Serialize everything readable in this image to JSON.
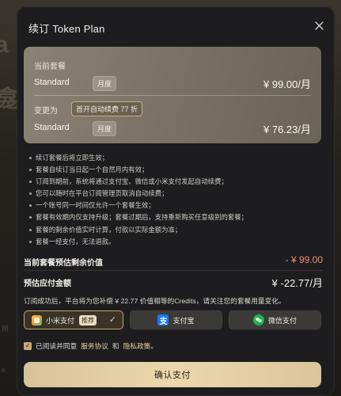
{
  "background": {
    "glyph_1": "a",
    "glyph_2": "龛",
    "small_1": "用",
    "small_2": "e"
  },
  "modal": {
    "title": "续订 Token Plan",
    "close_icon": "close-icon"
  },
  "plan_card": {
    "current_label": "当前套餐",
    "current_plan": "Standard",
    "current_cycle": "月度",
    "current_price": "¥ 99.00/月",
    "change_label": "变更为",
    "promo_badge": "首开自动续费 77 折",
    "new_plan": "Standard",
    "new_cycle": "月度",
    "new_price": "¥ 76.23/月"
  },
  "rules": [
    "续订套餐后将立即生效；",
    "套餐自续订当日起一个自然月内有效；",
    "订阅到期前，系统将通过支付宝、微信或小米支付发起自动续费；",
    "您可以随时在平台订阅管理页取消自动续费；",
    "一个账号同一时间仅允许一个套餐生效；",
    "套餐有效期内仅支持升级；套餐过期后，支持重新购买任意级别的套餐；",
    "套餐的剩余价值实时计算，付款以实际金额为准；",
    "套餐一经支付，无法退款。"
  ],
  "summary": {
    "remaining_label": "当前套餐预估剩余价值",
    "remaining_value": "- ¥ 99.00",
    "due_label": "预估应付金额",
    "due_value": "¥ -22.77/月"
  },
  "notice": "订阅成功后，平台将为您补偿 ¥ 22.77 价值相等的Credits，请关注您的套餐用量变化。",
  "payment_methods": [
    {
      "label": "小米支付",
      "badge": "推荐",
      "selected": true,
      "icon": "xiaomi-pay-icon"
    },
    {
      "label": "支付宝",
      "selected": false,
      "icon": "alipay-icon"
    },
    {
      "label": "微信支付",
      "selected": false,
      "icon": "wechat-pay-icon"
    }
  ],
  "agreement": {
    "checked": true,
    "prefix": "已阅读并同意",
    "service_link": "服务协议",
    "and": "和",
    "privacy_link": "隐私政策",
    "suffix": "。"
  },
  "confirm_button": "确认支付",
  "colors": {
    "accent_gold": "#c6a46a",
    "remaining_value": "#e98b6c",
    "confirm_button": "#e3cda3"
  }
}
